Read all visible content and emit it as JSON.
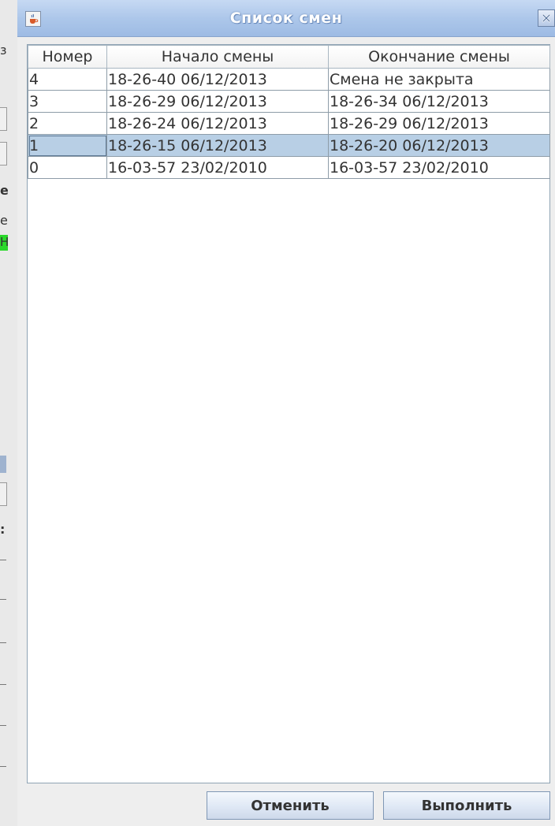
{
  "background_app": {
    "glyphs": [
      "з",
      "е",
      "еі",
      "Н",
      ":"
    ]
  },
  "dialog": {
    "title": "Список смен",
    "icons": {
      "app": "java-cup-icon",
      "close": "close-icon"
    }
  },
  "table": {
    "columns": [
      "Номер",
      "Начало смены",
      "Окончание смены"
    ],
    "rows": [
      [
        "4",
        "18-26-40 06/12/2013",
        "Смена не закрыта"
      ],
      [
        "3",
        "18-26-29 06/12/2013",
        "18-26-34 06/12/2013"
      ],
      [
        "2",
        "18-26-24 06/12/2013",
        "18-26-29 06/12/2013"
      ],
      [
        "1",
        "18-26-15 06/12/2013",
        "18-26-20 06/12/2013"
      ],
      [
        "0",
        "16-03-57 23/02/2010",
        "16-03-57 23/02/2010"
      ]
    ],
    "selected_row": 3
  },
  "buttons": {
    "cancel": "Отменить",
    "execute": "Выполнить"
  },
  "colors": {
    "title_gradient_top": "#c6d9f3",
    "title_gradient_bottom": "#9dbbe4",
    "selection": "#b8cfe5",
    "status_green": "#2bd82b"
  }
}
